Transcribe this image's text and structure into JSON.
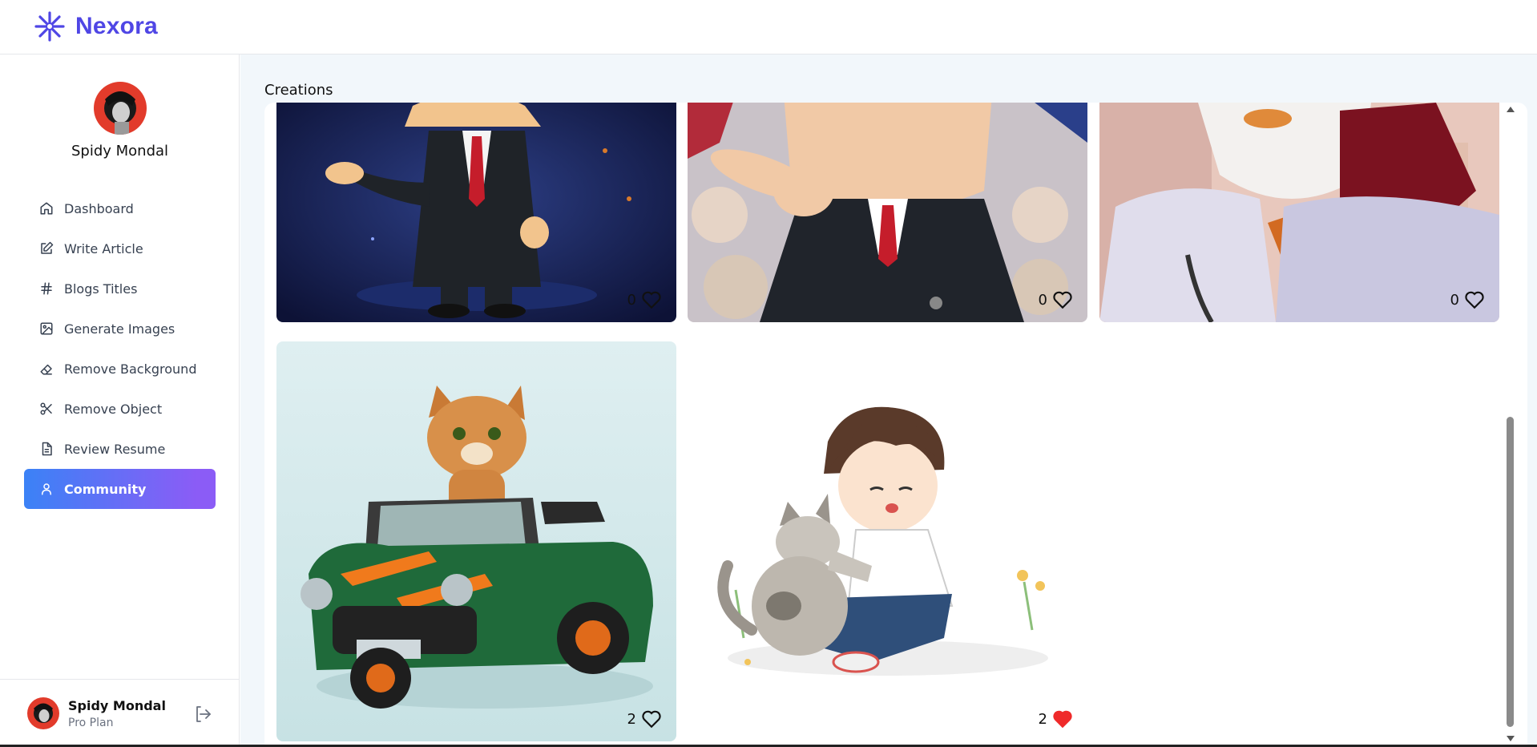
{
  "app": {
    "name": "Nexora",
    "brand_color": "#4f46e5"
  },
  "user": {
    "name": "Spidy Mondal",
    "plan": "Pro Plan"
  },
  "nav": {
    "items": [
      {
        "label": "Dashboard",
        "icon": "home-icon"
      },
      {
        "label": "Write Article",
        "icon": "edit-icon"
      },
      {
        "label": "Blogs Titles",
        "icon": "hash-icon"
      },
      {
        "label": "Generate Images",
        "icon": "image-icon"
      },
      {
        "label": "Remove Background",
        "icon": "eraser-icon"
      },
      {
        "label": "Remove Object",
        "icon": "scissors-icon"
      },
      {
        "label": "Review Resume",
        "icon": "file-text-icon"
      },
      {
        "label": "Community",
        "icon": "user-icon",
        "active": true
      }
    ]
  },
  "main": {
    "title": "Creations",
    "creations": [
      {
        "subject": "cartoon businessman in suit pointing",
        "likes": "0",
        "liked": false
      },
      {
        "subject": "cartoon politician pointing at crowd",
        "likes": "0",
        "liked": false
      },
      {
        "subject": "cartoon bearded man in white kurta",
        "likes": "0",
        "liked": false
      },
      {
        "subject": "cat driving green toy car",
        "likes": "2",
        "liked": false
      },
      {
        "subject": "boy hugging cat illustration",
        "likes": "2",
        "liked": true
      }
    ]
  },
  "colors": {
    "active_gradient_start": "#3b82f6",
    "active_gradient_end": "#8b5cf6",
    "liked_heart": "#ef2a2a"
  }
}
